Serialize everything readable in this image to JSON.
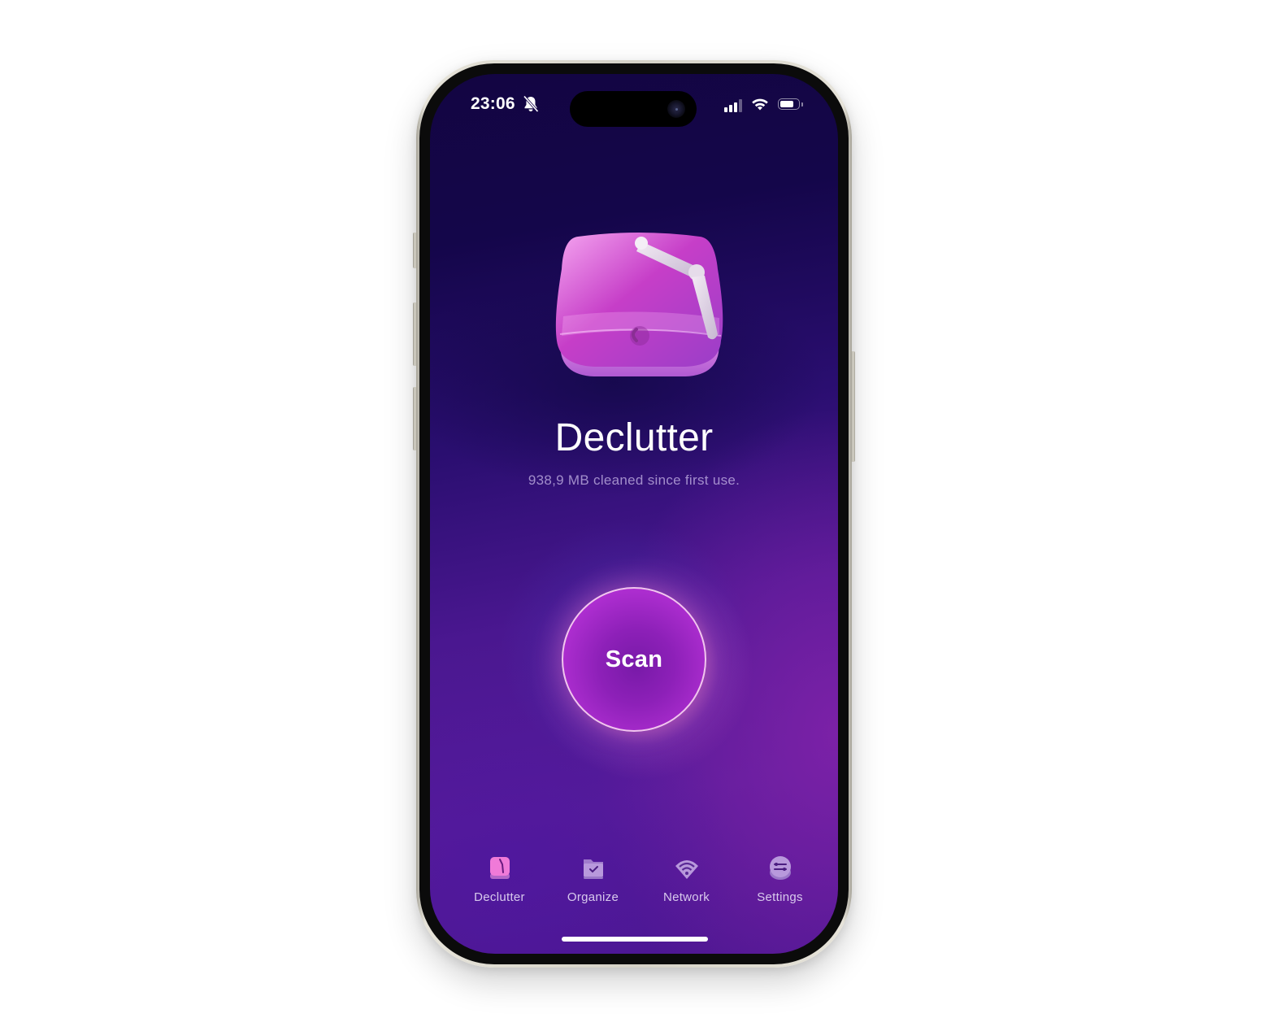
{
  "status_bar": {
    "time": "23:06",
    "icons": [
      "bell-slash-icon",
      "cellular-signal-icon",
      "wifi-icon",
      "battery-icon"
    ]
  },
  "app": {
    "icon": "declutter-app-icon",
    "title": "Declutter",
    "subtitle": "938,9 MB cleaned since first use."
  },
  "scan": {
    "label": "Scan"
  },
  "tabs": [
    {
      "label": "Declutter",
      "icon": "declutter-icon",
      "active": true
    },
    {
      "label": "Organize",
      "icon": "organize-folder-icon",
      "active": false
    },
    {
      "label": "Network",
      "icon": "network-wifi-icon",
      "active": false
    },
    {
      "label": "Settings",
      "icon": "settings-toggle-icon",
      "active": false
    }
  ],
  "colors": {
    "accent": "#c23ce0",
    "active_tab_icon": "#f07ad8",
    "inactive_tab_icon": "#b496d8",
    "background_top": "#130542",
    "background_bottom": "#561c98"
  }
}
